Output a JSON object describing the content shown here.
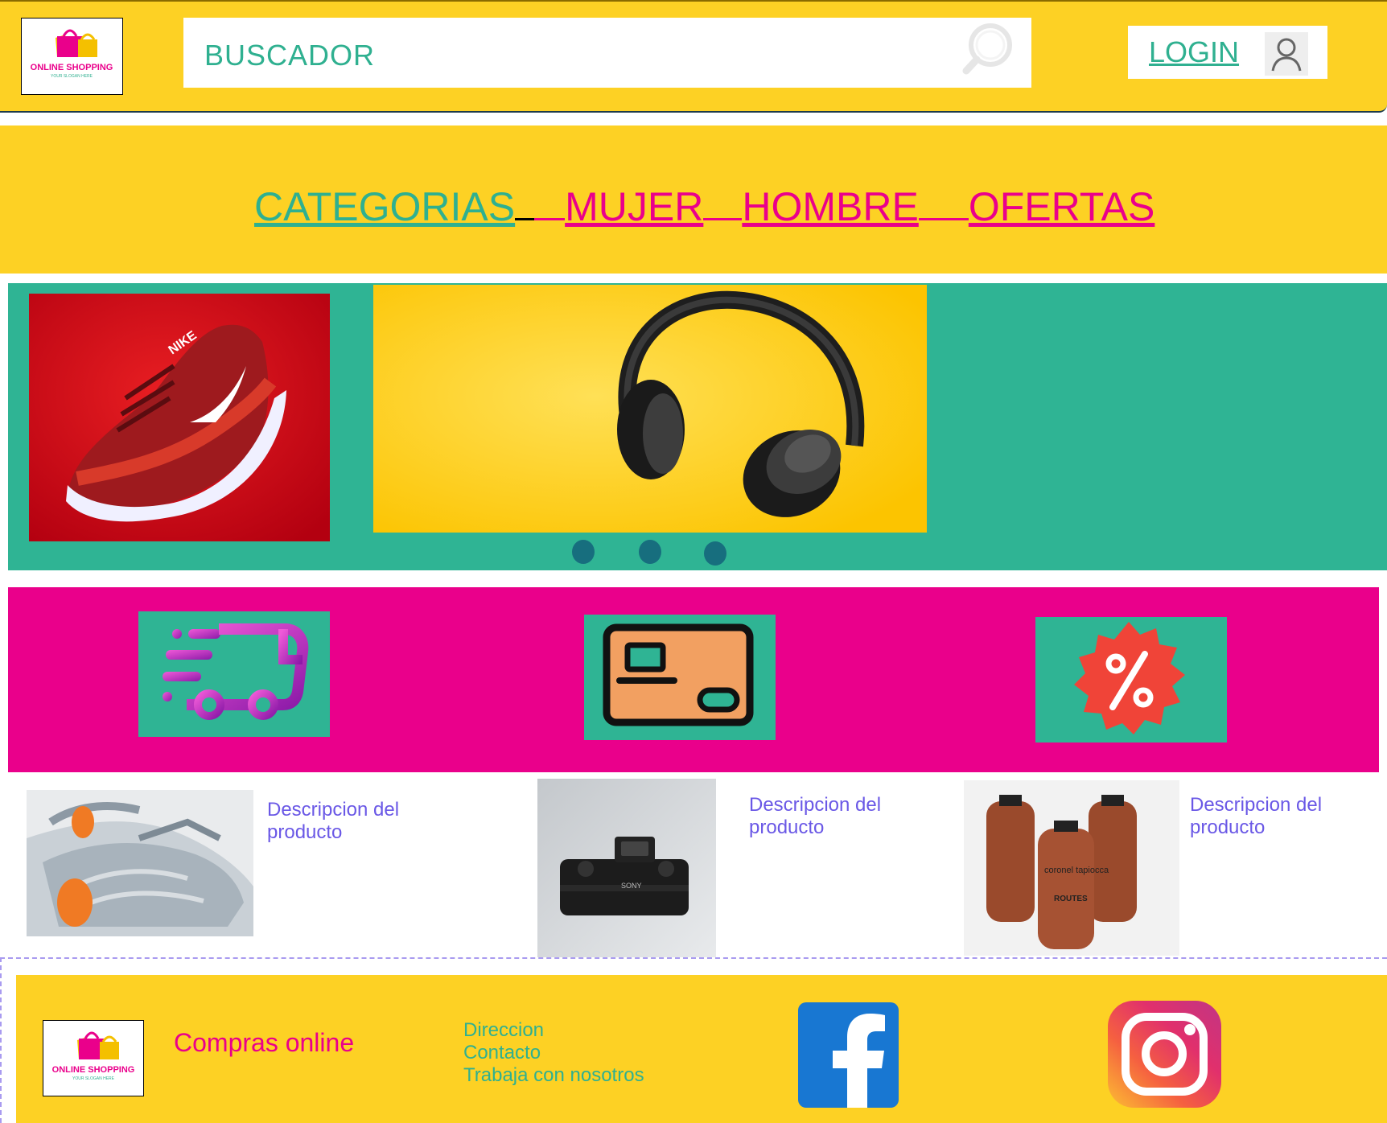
{
  "header": {
    "logo_text": "ONLINE SHOPPING",
    "logo_tagline": "YOUR SLOGAN HERE",
    "search_placeholder": "BUSCADOR",
    "login_label": "LOGIN"
  },
  "nav": {
    "items": [
      "CATEGORIAS",
      "MUJER",
      "HOMBRE",
      "OFERTAS"
    ]
  },
  "carousel": {
    "slides": [
      "shoe",
      "headphones"
    ],
    "dots": 3,
    "shoe_brand": "NIKE"
  },
  "features": {
    "icons": [
      "delivery-truck-icon",
      "credit-card-icon",
      "discount-percent-icon"
    ]
  },
  "products": [
    {
      "image": "sneakers",
      "description": "Descripcion del producto"
    },
    {
      "image": "camera",
      "description": "Descripcion del producto",
      "brand": "SONY"
    },
    {
      "image": "bottles",
      "description": "Descripcion del producto",
      "brand": "coronel tapiocca",
      "label": "ROUTES"
    }
  ],
  "footer": {
    "title": "Compras online",
    "links": [
      "Direccion",
      "Contacto",
      "Trabaja con nosotros"
    ]
  },
  "colors": {
    "yellow": "#fdd124",
    "teal": "#2fb494",
    "pink": "#ea008b",
    "purple_text": "#6a58e6"
  }
}
